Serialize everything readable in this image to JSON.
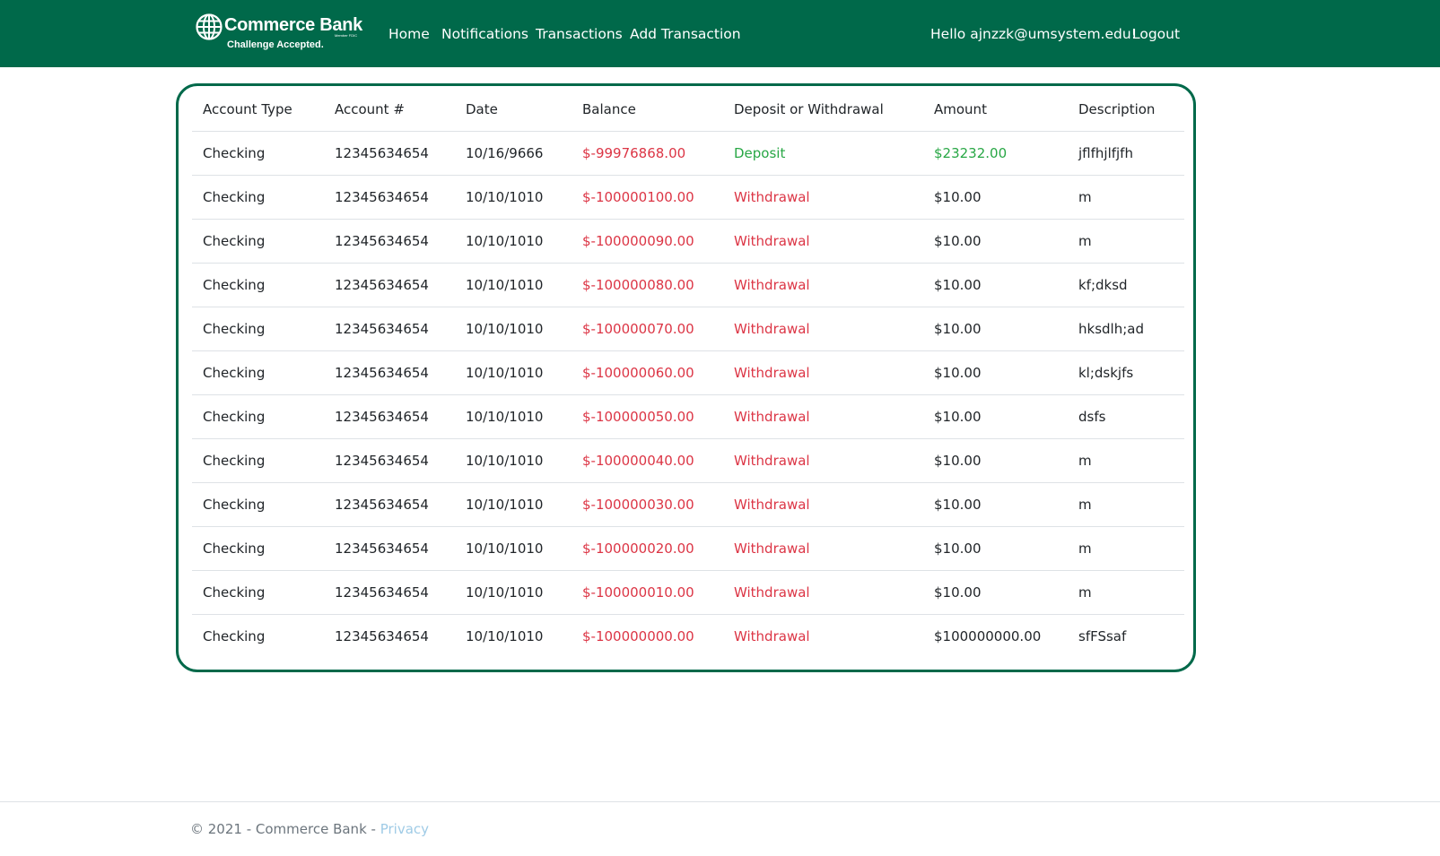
{
  "colors": {
    "brand_green": "#00694a",
    "negative": "#dc3545",
    "positive": "#28a745",
    "footer_text": "#6c757d",
    "footer_link": "#9fcbe6"
  },
  "brand": {
    "name": "Commerce Bank",
    "fdic": "Member FDIC",
    "tagline": "Challenge Accepted.",
    "icon": "globe-icon"
  },
  "nav": {
    "home": "Home",
    "notifications": "Notifications",
    "transactions": "Transactions",
    "add_transaction": "Add Transaction",
    "greeting": "Hello ajnzzk@umsystem.edu!",
    "logout": "Logout"
  },
  "table": {
    "headers": [
      "Account Type",
      "Account #",
      "Date",
      "Balance",
      "Deposit or Withdrawal",
      "Amount",
      "Description"
    ],
    "rows": [
      [
        "Checking",
        "12345634654",
        "10/16/9666",
        "$-99976868.00",
        "Deposit",
        "$23232.00",
        "jflfhjlfjfh"
      ],
      [
        "Checking",
        "12345634654",
        "10/10/1010",
        "$-100000100.00",
        "Withdrawal",
        "$10.00",
        "m"
      ],
      [
        "Checking",
        "12345634654",
        "10/10/1010",
        "$-100000090.00",
        "Withdrawal",
        "$10.00",
        "m"
      ],
      [
        "Checking",
        "12345634654",
        "10/10/1010",
        "$-100000080.00",
        "Withdrawal",
        "$10.00",
        "kf;dksd"
      ],
      [
        "Checking",
        "12345634654",
        "10/10/1010",
        "$-100000070.00",
        "Withdrawal",
        "$10.00",
        "hksdlh;ad"
      ],
      [
        "Checking",
        "12345634654",
        "10/10/1010",
        "$-100000060.00",
        "Withdrawal",
        "$10.00",
        "kl;dskjfs"
      ],
      [
        "Checking",
        "12345634654",
        "10/10/1010",
        "$-100000050.00",
        "Withdrawal",
        "$10.00",
        "dsfs"
      ],
      [
        "Checking",
        "12345634654",
        "10/10/1010",
        "$-100000040.00",
        "Withdrawal",
        "$10.00",
        "m"
      ],
      [
        "Checking",
        "12345634654",
        "10/10/1010",
        "$-100000030.00",
        "Withdrawal",
        "$10.00",
        "m"
      ],
      [
        "Checking",
        "12345634654",
        "10/10/1010",
        "$-100000020.00",
        "Withdrawal",
        "$10.00",
        "m"
      ],
      [
        "Checking",
        "12345634654",
        "10/10/1010",
        "$-100000010.00",
        "Withdrawal",
        "$10.00",
        "m"
      ],
      [
        "Checking",
        "12345634654",
        "10/10/1010",
        "$-100000000.00",
        "Withdrawal",
        "$100000000.00",
        "sfFSsaf"
      ]
    ]
  },
  "footer": {
    "text": "© 2021 - Commerce Bank - ",
    "privacy": "Privacy"
  }
}
